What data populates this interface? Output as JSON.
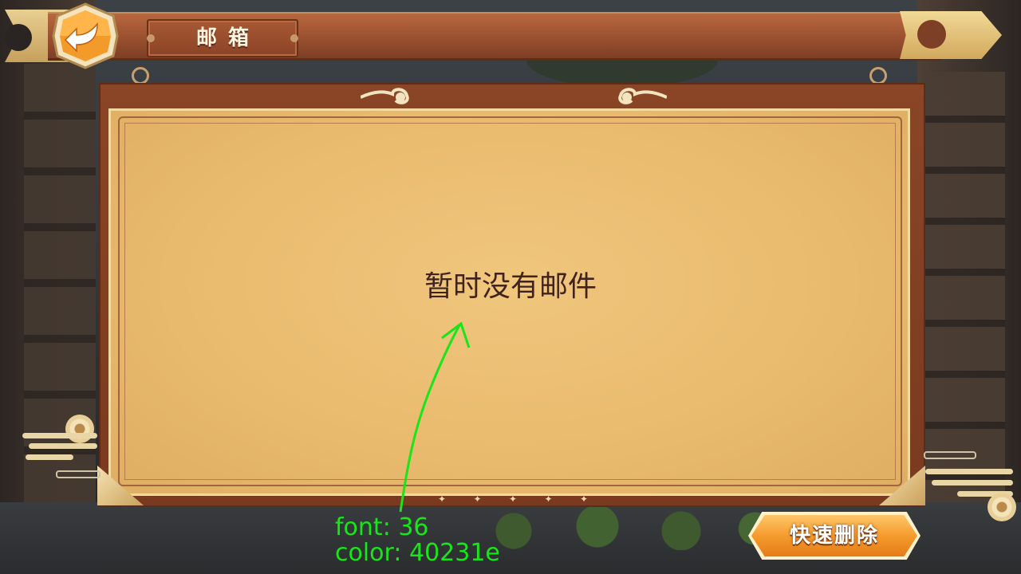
{
  "header": {
    "title": "邮箱",
    "back_icon": "back-arrow-icon"
  },
  "main": {
    "empty_message": "暂时没有邮件"
  },
  "footer": {
    "quick_delete_label": "快速删除"
  },
  "annotation": {
    "font_line": "font: 36",
    "color_line": "color: 40231e"
  },
  "colors": {
    "message_text": "#40231e",
    "annotation": "#19e51b",
    "panel_bg": "#e8ba6d",
    "button_orange": "#f39a2c"
  }
}
